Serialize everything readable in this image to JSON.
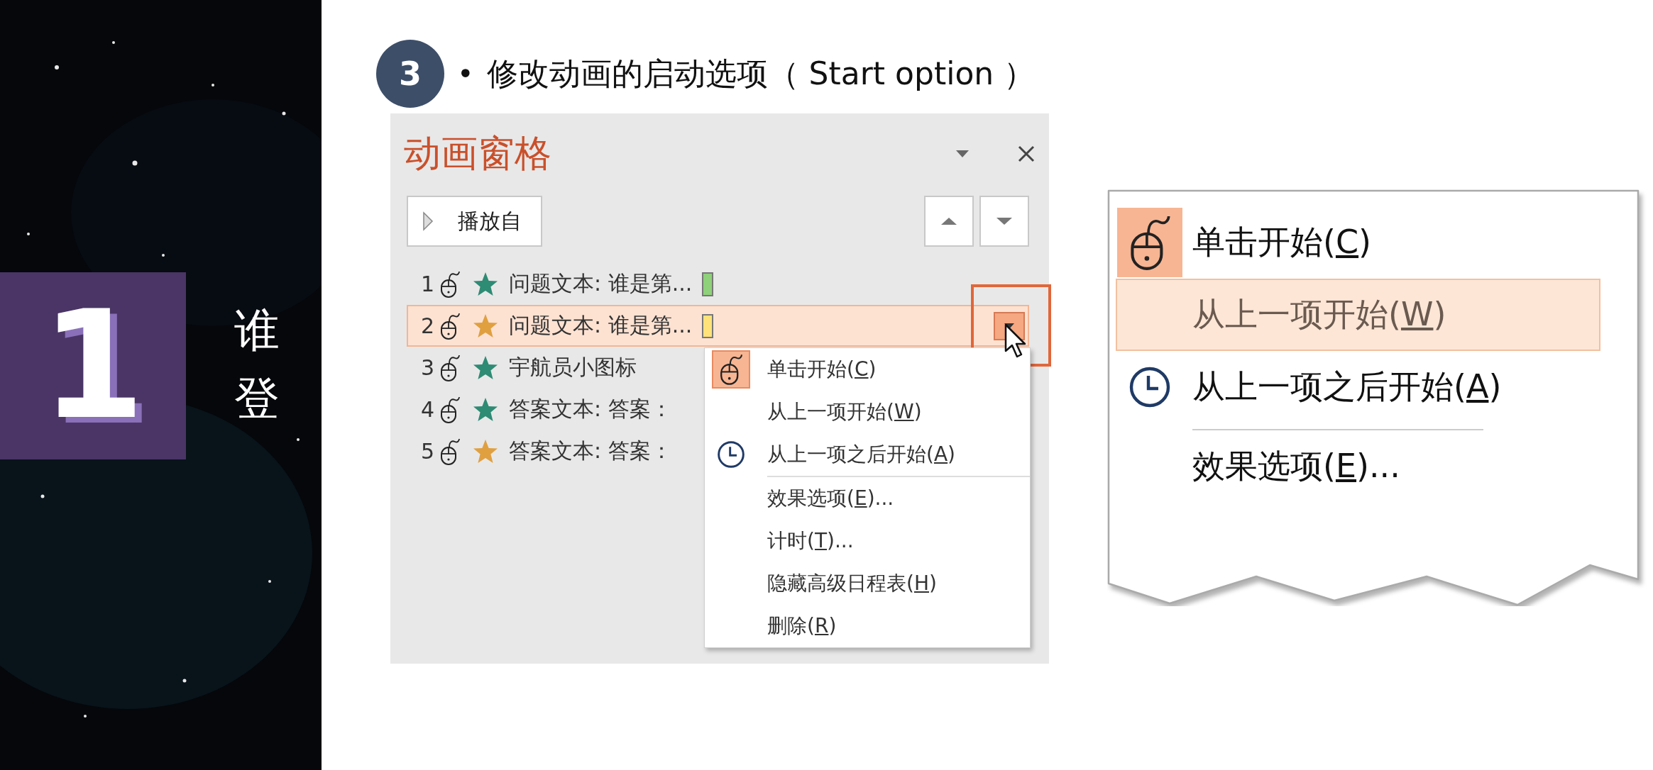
{
  "slide_side": {
    "number": "1",
    "title_lines": [
      "谁",
      "登"
    ]
  },
  "step": {
    "badge": "3",
    "bullet": "•",
    "heading": "修改动画的启动选项（ Start option ）"
  },
  "animation_pane": {
    "title": "动画窗格",
    "play_button": "播放自",
    "items": [
      {
        "number": "1",
        "color": "#2e8b74",
        "text": "问题文本: 谁是第...",
        "bar": {
          "color": "#8fd07a"
        },
        "selected": false
      },
      {
        "number": "2",
        "color": "#e0a040",
        "text": "问题文本: 谁是第...",
        "bar": {
          "color": "#ffe27a"
        },
        "selected": true
      },
      {
        "number": "3",
        "color": "#2e8b74",
        "text": "宇航员小图标",
        "selected": false
      },
      {
        "number": "4",
        "color": "#2e8b74",
        "text": "答案文本: 答案：",
        "selected": false
      },
      {
        "number": "5",
        "color": "#e0a040",
        "text": "答案文本: 答案：",
        "selected": false
      }
    ],
    "context_menu": {
      "items": [
        {
          "kind": "click",
          "before": "单击开始(",
          "key": "C",
          "after": ")",
          "checked": true,
          "separator_above": false
        },
        {
          "kind": "plain",
          "before": "从上一项开始(",
          "key": "W",
          "after": ")",
          "checked": false,
          "separator_above": false
        },
        {
          "kind": "after",
          "before": "从上一项之后开始(",
          "key": "A",
          "after": ")",
          "checked": false,
          "separator_above": false
        },
        {
          "kind": "plain",
          "before": "效果选项(",
          "key": "E",
          "after": ")...",
          "checked": false,
          "separator_above": true
        },
        {
          "kind": "plain",
          "before": "计时(",
          "key": "T",
          "after": ")...",
          "checked": false,
          "separator_above": false
        },
        {
          "kind": "plain",
          "before": "隐藏高级日程表(",
          "key": "H",
          "after": ")",
          "checked": false,
          "separator_above": false
        },
        {
          "kind": "plain",
          "before": "删除(",
          "key": "R",
          "after": ")",
          "checked": false,
          "separator_above": false
        }
      ]
    }
  },
  "callout": {
    "items": [
      {
        "kind": "click",
        "before": "单击开始(",
        "key": "C",
        "after": ")",
        "checked": true,
        "selected": false,
        "separator_above": false
      },
      {
        "kind": "plain",
        "before": "从上一项开始(",
        "key": "W",
        "after": ")",
        "checked": false,
        "selected": true,
        "separator_above": false
      },
      {
        "kind": "after",
        "before": "从上一项之后开始(",
        "key": "A",
        "after": ")",
        "checked": false,
        "selected": false,
        "separator_above": false
      },
      {
        "kind": "plain",
        "before": "效果选项(",
        "key": "E",
        "after": ")...",
        "checked": false,
        "selected": false,
        "separator_above": true
      }
    ]
  }
}
